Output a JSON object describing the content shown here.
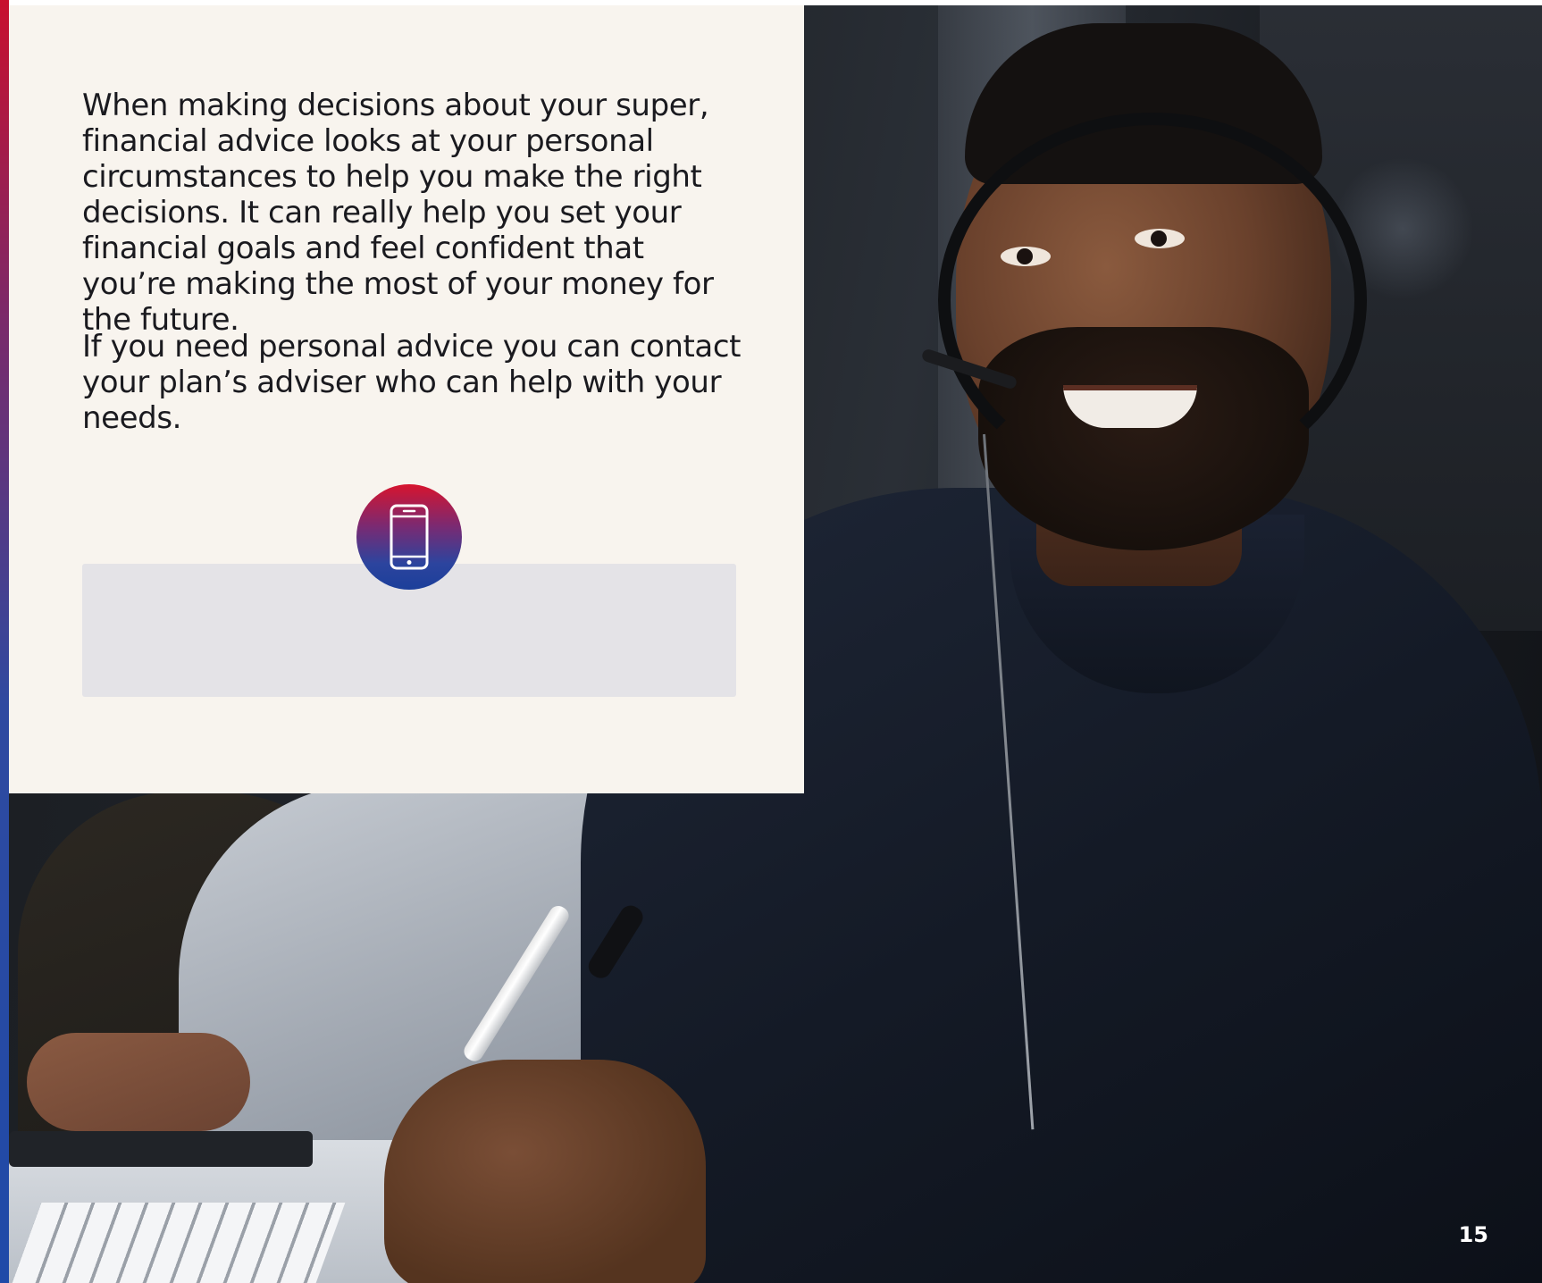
{
  "body": {
    "paragraph_1": "When making decisions about your super, financial advice looks at your personal circumstances to help you make the right decisions. It can really help you set your financial goals and feel confident that you’re making the most of your money for the future.",
    "paragraph_2": "If you need personal advice you can contact your plan’s adviser who can help with your needs."
  },
  "icons": {
    "badge_icon": "mobile-phone-icon"
  },
  "colors": {
    "panel_background": "#f8f4ee",
    "contact_box": "#e4e3e7",
    "accent_red": "#c8102e",
    "accent_blue": "#1f4aa8"
  },
  "page": {
    "number": "15"
  }
}
